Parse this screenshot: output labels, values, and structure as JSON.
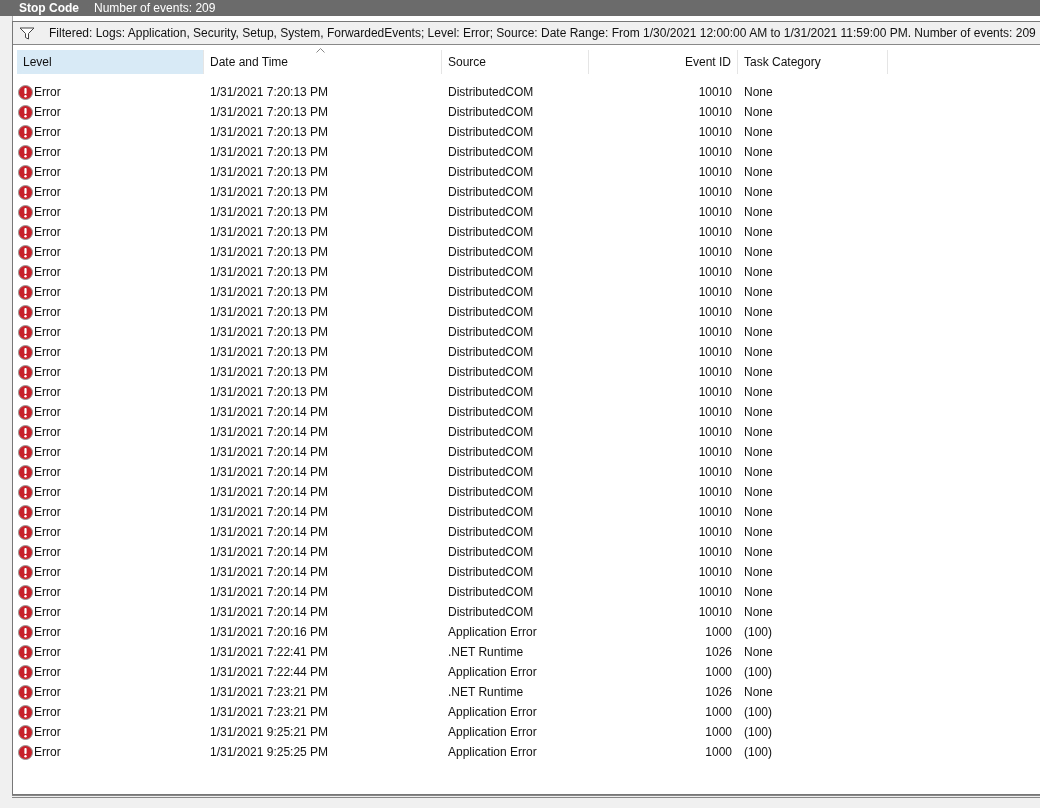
{
  "title_bar": {
    "title": "Stop Code",
    "count": "Number of events: 209"
  },
  "filter_bar": {
    "text": "Filtered: Logs: Application, Security, Setup, System, ForwardedEvents; Level: Error; Source: Date Range: From 1/30/2021 12:00:00 AM to 1/31/2021 11:59:00 PM. Number of events: 209"
  },
  "table": {
    "columns": [
      {
        "label": "Level",
        "selected": true,
        "sorted": false
      },
      {
        "label": "Date and Time",
        "selected": false,
        "sorted": true
      },
      {
        "label": "Source",
        "selected": false,
        "sorted": false
      },
      {
        "label": "Event ID",
        "selected": false,
        "sorted": false
      },
      {
        "label": "Task Category",
        "selected": false,
        "sorted": false
      }
    ],
    "rows": [
      {
        "kind": "error",
        "severity": "Error",
        "date": "1/31/2021 7:20:13 PM",
        "source": "DistributedCOM",
        "event_id": "10010",
        "task_category": "None"
      },
      {
        "kind": "error",
        "severity": "Error",
        "date": "1/31/2021 7:20:13 PM",
        "source": "DistributedCOM",
        "event_id": "10010",
        "task_category": "None"
      },
      {
        "kind": "error",
        "severity": "Error",
        "date": "1/31/2021 7:20:13 PM",
        "source": "DistributedCOM",
        "event_id": "10010",
        "task_category": "None"
      },
      {
        "kind": "error",
        "severity": "Error",
        "date": "1/31/2021 7:20:13 PM",
        "source": "DistributedCOM",
        "event_id": "10010",
        "task_category": "None"
      },
      {
        "kind": "error",
        "severity": "Error",
        "date": "1/31/2021 7:20:13 PM",
        "source": "DistributedCOM",
        "event_id": "10010",
        "task_category": "None"
      },
      {
        "kind": "error",
        "severity": "Error",
        "date": "1/31/2021 7:20:13 PM",
        "source": "DistributedCOM",
        "event_id": "10010",
        "task_category": "None"
      },
      {
        "kind": "error",
        "severity": "Error",
        "date": "1/31/2021 7:20:13 PM",
        "source": "DistributedCOM",
        "event_id": "10010",
        "task_category": "None"
      },
      {
        "kind": "error",
        "severity": "Error",
        "date": "1/31/2021 7:20:13 PM",
        "source": "DistributedCOM",
        "event_id": "10010",
        "task_category": "None"
      },
      {
        "kind": "error",
        "severity": "Error",
        "date": "1/31/2021 7:20:13 PM",
        "source": "DistributedCOM",
        "event_id": "10010",
        "task_category": "None"
      },
      {
        "kind": "error",
        "severity": "Error",
        "date": "1/31/2021 7:20:13 PM",
        "source": "DistributedCOM",
        "event_id": "10010",
        "task_category": "None"
      },
      {
        "kind": "error",
        "severity": "Error",
        "date": "1/31/2021 7:20:13 PM",
        "source": "DistributedCOM",
        "event_id": "10010",
        "task_category": "None"
      },
      {
        "kind": "error",
        "severity": "Error",
        "date": "1/31/2021 7:20:13 PM",
        "source": "DistributedCOM",
        "event_id": "10010",
        "task_category": "None"
      },
      {
        "kind": "error",
        "severity": "Error",
        "date": "1/31/2021 7:20:13 PM",
        "source": "DistributedCOM",
        "event_id": "10010",
        "task_category": "None"
      },
      {
        "kind": "error",
        "severity": "Error",
        "date": "1/31/2021 7:20:13 PM",
        "source": "DistributedCOM",
        "event_id": "10010",
        "task_category": "None"
      },
      {
        "kind": "error",
        "severity": "Error",
        "date": "1/31/2021 7:20:13 PM",
        "source": "DistributedCOM",
        "event_id": "10010",
        "task_category": "None"
      },
      {
        "kind": "error",
        "severity": "Error",
        "date": "1/31/2021 7:20:13 PM",
        "source": "DistributedCOM",
        "event_id": "10010",
        "task_category": "None"
      },
      {
        "kind": "error",
        "severity": "Error",
        "date": "1/31/2021 7:20:14 PM",
        "source": "DistributedCOM",
        "event_id": "10010",
        "task_category": "None"
      },
      {
        "kind": "error",
        "severity": "Error",
        "date": "1/31/2021 7:20:14 PM",
        "source": "DistributedCOM",
        "event_id": "10010",
        "task_category": "None"
      },
      {
        "kind": "error",
        "severity": "Error",
        "date": "1/31/2021 7:20:14 PM",
        "source": "DistributedCOM",
        "event_id": "10010",
        "task_category": "None"
      },
      {
        "kind": "error",
        "severity": "Error",
        "date": "1/31/2021 7:20:14 PM",
        "source": "DistributedCOM",
        "event_id": "10010",
        "task_category": "None"
      },
      {
        "kind": "error",
        "severity": "Error",
        "date": "1/31/2021 7:20:14 PM",
        "source": "DistributedCOM",
        "event_id": "10010",
        "task_category": "None"
      },
      {
        "kind": "error",
        "severity": "Error",
        "date": "1/31/2021 7:20:14 PM",
        "source": "DistributedCOM",
        "event_id": "10010",
        "task_category": "None"
      },
      {
        "kind": "error",
        "severity": "Error",
        "date": "1/31/2021 7:20:14 PM",
        "source": "DistributedCOM",
        "event_id": "10010",
        "task_category": "None"
      },
      {
        "kind": "error",
        "severity": "Error",
        "date": "1/31/2021 7:20:14 PM",
        "source": "DistributedCOM",
        "event_id": "10010",
        "task_category": "None"
      },
      {
        "kind": "error",
        "severity": "Error",
        "date": "1/31/2021 7:20:14 PM",
        "source": "DistributedCOM",
        "event_id": "10010",
        "task_category": "None"
      },
      {
        "kind": "error",
        "severity": "Error",
        "date": "1/31/2021 7:20:14 PM",
        "source": "DistributedCOM",
        "event_id": "10010",
        "task_category": "None"
      },
      {
        "kind": "error",
        "severity": "Error",
        "date": "1/31/2021 7:20:14 PM",
        "source": "DistributedCOM",
        "event_id": "10010",
        "task_category": "None"
      },
      {
        "kind": "error",
        "severity": "Error",
        "date": "1/31/2021 7:20:16 PM",
        "source": "Application Error",
        "event_id": "1000",
        "task_category": "(100)"
      },
      {
        "kind": "error",
        "severity": "Error",
        "date": "1/31/2021 7:22:41 PM",
        "source": ".NET Runtime",
        "event_id": "1026",
        "task_category": "None"
      },
      {
        "kind": "error",
        "severity": "Error",
        "date": "1/31/2021 7:22:44 PM",
        "source": "Application Error",
        "event_id": "1000",
        "task_category": "(100)"
      },
      {
        "kind": "error",
        "severity": "Error",
        "date": "1/31/2021 7:23:21 PM",
        "source": ".NET Runtime",
        "event_id": "1026",
        "task_category": "None"
      },
      {
        "kind": "error",
        "severity": "Error",
        "date": "1/31/2021 7:23:21 PM",
        "source": "Application Error",
        "event_id": "1000",
        "task_category": "(100)"
      },
      {
        "kind": "error",
        "severity": "Error",
        "date": "1/31/2021 9:25:21 PM",
        "source": "Application Error",
        "event_id": "1000",
        "task_category": "(100)"
      },
      {
        "kind": "error",
        "severity": "Error",
        "date": "1/31/2021 9:25:25 PM",
        "source": "Application Error",
        "event_id": "1000",
        "task_category": "(100)"
      }
    ]
  }
}
